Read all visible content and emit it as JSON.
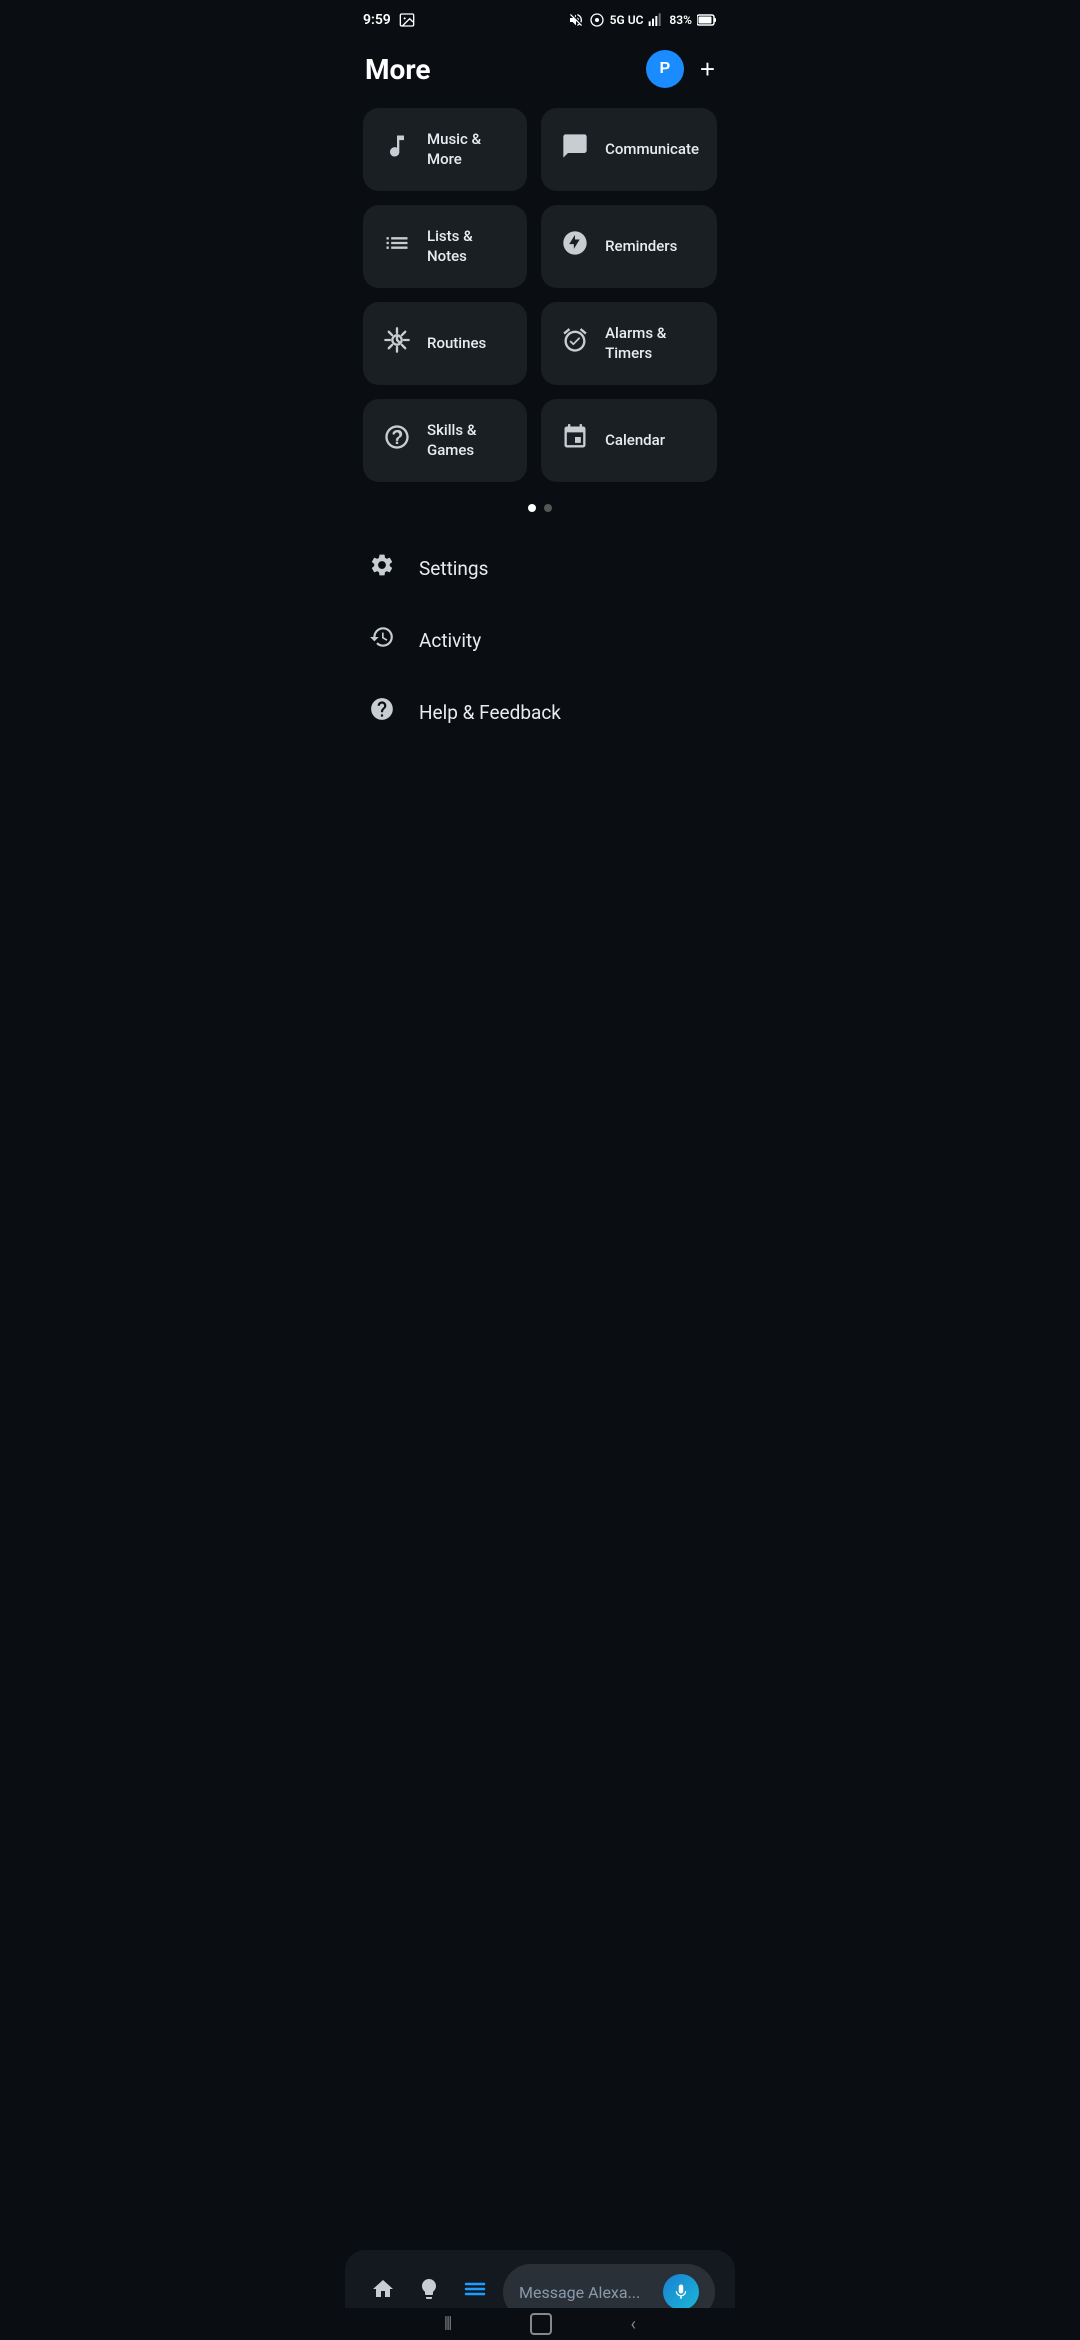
{
  "statusBar": {
    "time": "9:59",
    "network": "5G UC",
    "battery": "83%"
  },
  "header": {
    "title": "More",
    "profileInitial": "P",
    "addButton": "+"
  },
  "grid": {
    "cards": [
      {
        "id": "music-more",
        "label": "Music & More",
        "icon": "music"
      },
      {
        "id": "communicate",
        "label": "Communicate",
        "icon": "communicate"
      },
      {
        "id": "lists-notes",
        "label": "Lists & Notes",
        "icon": "lists"
      },
      {
        "id": "reminders",
        "label": "Reminders",
        "icon": "reminders"
      },
      {
        "id": "routines",
        "label": "Routines",
        "icon": "routines"
      },
      {
        "id": "alarms-timers",
        "label": "Alarms & Timers",
        "icon": "alarms"
      },
      {
        "id": "skills-games",
        "label": "Skills & Games",
        "icon": "skills"
      },
      {
        "id": "calendar",
        "label": "Calendar",
        "icon": "calendar"
      }
    ]
  },
  "pagination": {
    "totalDots": 2,
    "activeDot": 0
  },
  "menuItems": [
    {
      "id": "settings",
      "label": "Settings",
      "icon": "gear"
    },
    {
      "id": "activity",
      "label": "Activity",
      "icon": "activity"
    },
    {
      "id": "help-feedback",
      "label": "Help & Feedback",
      "icon": "help"
    }
  ],
  "bottomBar": {
    "messagePlaceholder": "Message Alexa..."
  }
}
